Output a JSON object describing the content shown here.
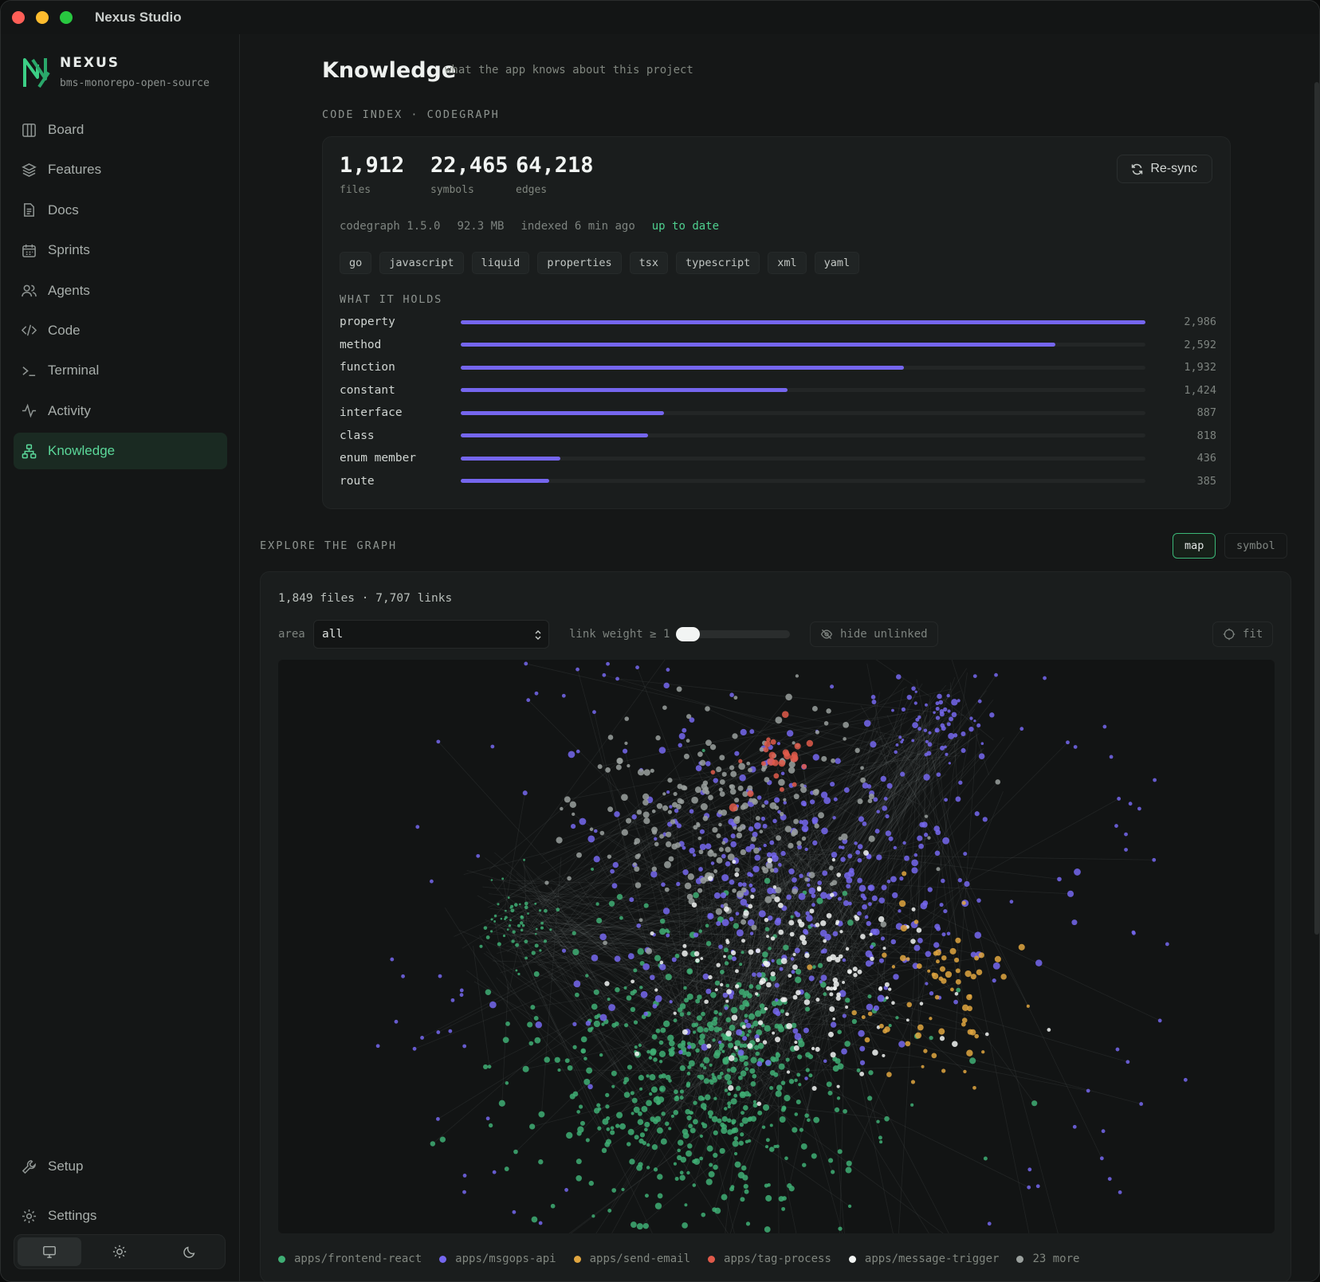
{
  "window": {
    "title": "Nexus Studio"
  },
  "brand": {
    "name": "NEXUS",
    "project": "bms-monorepo-open-source"
  },
  "sidebar": {
    "items": [
      {
        "label": "Board",
        "icon": "board-icon"
      },
      {
        "label": "Features",
        "icon": "layers-icon"
      },
      {
        "label": "Docs",
        "icon": "doc-icon"
      },
      {
        "label": "Sprints",
        "icon": "calendar-icon"
      },
      {
        "label": "Agents",
        "icon": "users-icon"
      },
      {
        "label": "Code",
        "icon": "code-icon"
      },
      {
        "label": "Terminal",
        "icon": "terminal-icon"
      },
      {
        "label": "Activity",
        "icon": "activity-icon"
      },
      {
        "label": "Knowledge",
        "icon": "network-icon",
        "active": true
      }
    ],
    "bottom": [
      {
        "label": "Setup",
        "icon": "wrench-icon"
      },
      {
        "label": "Settings",
        "icon": "gear-icon"
      }
    ],
    "theme": {
      "options": [
        "monitor-icon",
        "sun-icon",
        "moon-icon"
      ],
      "selected": "monitor-icon"
    }
  },
  "page": {
    "title": "Knowledge",
    "subtitle": "what the app knows about this project"
  },
  "code_index": {
    "section_label": "CODE INDEX · CODEGRAPH",
    "stats": [
      {
        "value": "1,912",
        "label": "files"
      },
      {
        "value": "22,465",
        "label": "symbols"
      },
      {
        "value": "64,218",
        "label": "edges"
      }
    ],
    "resync_label": "Re-sync",
    "meta": {
      "version": "codegraph 1.5.0",
      "size": "92.3 MB",
      "indexed": "indexed 6 min ago",
      "status": "up to date"
    },
    "languages": [
      "go",
      "javascript",
      "liquid",
      "properties",
      "tsx",
      "typescript",
      "xml",
      "yaml"
    ],
    "holds_label": "WHAT IT HOLDS"
  },
  "chart_data": {
    "type": "bar",
    "title": "WHAT IT HOLDS",
    "categories": [
      "property",
      "method",
      "function",
      "constant",
      "interface",
      "class",
      "enum member",
      "route"
    ],
    "values": [
      2986,
      2592,
      1932,
      1424,
      887,
      818,
      436,
      385
    ],
    "labels": [
      "2,986",
      "2,592",
      "1,932",
      "1,424",
      "887",
      "818",
      "436",
      "385"
    ],
    "orientation": "horizontal",
    "xlim": [
      0,
      2986
    ]
  },
  "explore": {
    "section_label": "EXPLORE THE GRAPH",
    "modes": [
      "map",
      "symbol"
    ],
    "selected_mode": "map",
    "count_text": "1,849 files · 7,707 links",
    "area_label": "area",
    "area_value": "all",
    "link_weight_label": "link weight ≥ 1",
    "link_weight_value": 1,
    "hide_unlinked_label": "hide unlinked",
    "fit_label": "fit",
    "legend": [
      {
        "label": "apps/frontend-react",
        "color": "#3fae74"
      },
      {
        "label": "apps/msgops-api",
        "color": "#7567ef"
      },
      {
        "label": "apps/send-email",
        "color": "#e0a640"
      },
      {
        "label": "apps/tag-process",
        "color": "#e05a4a"
      },
      {
        "label": "apps/message-trigger",
        "color": "#f2f4f3"
      },
      {
        "label": "23 more",
        "color": "#9aa09d"
      }
    ]
  },
  "colors": {
    "accent": "#5bd89a",
    "bar": "#7566ee",
    "ok": "#4fd08f"
  }
}
